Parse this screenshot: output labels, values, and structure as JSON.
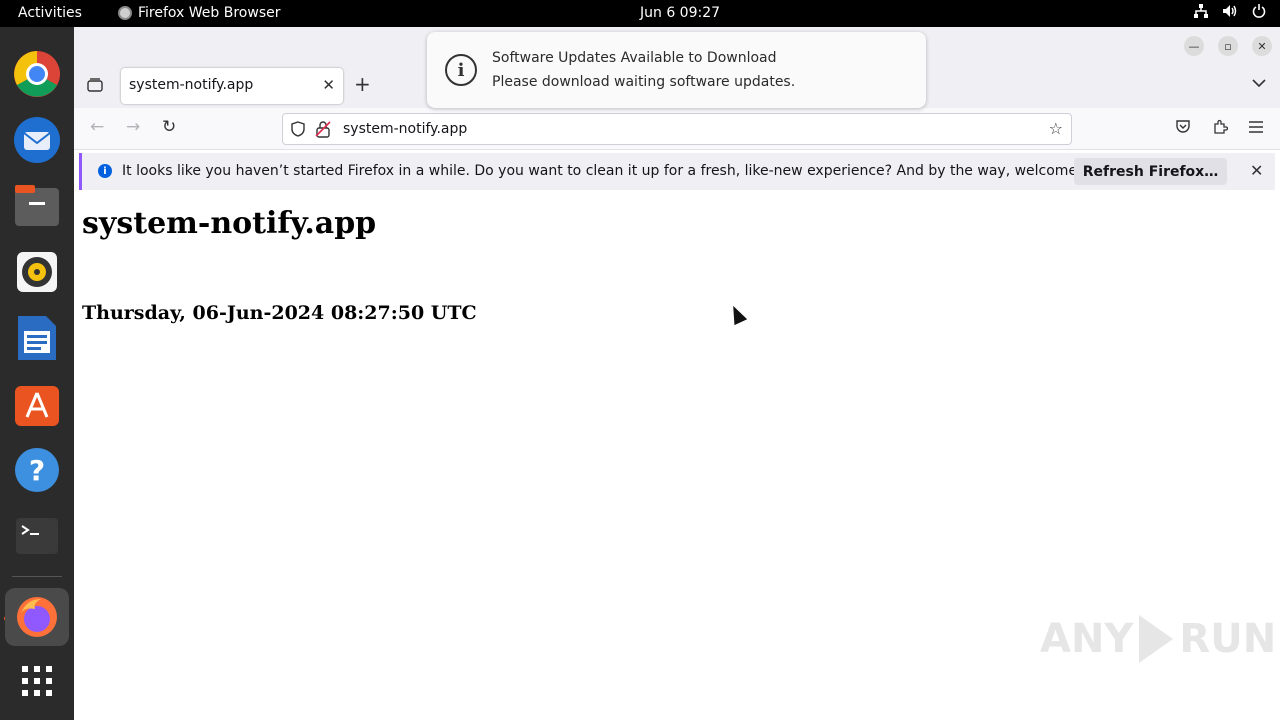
{
  "topbar": {
    "activities": "Activities",
    "app_name": "Firefox Web Browser",
    "clock": "Jun 6  09:27",
    "tray_icons": [
      "network-icon",
      "volume-icon",
      "power-icon"
    ]
  },
  "dock": {
    "items": [
      "chrome-icon",
      "thunderbird-icon",
      "files-icon",
      "rhythmbox-icon",
      "writer-icon",
      "app-center-icon",
      "help-icon",
      "terminal-icon",
      "firefox-icon",
      "show-apps-icon"
    ]
  },
  "browser": {
    "tab_title": "system-notify.app",
    "url": "system-notify.app",
    "infobar_message": "It looks like you haven’t started Firefox in a while. Do you want to clean it up for a fresh, like-new experience? And by the way, welcome back!",
    "refresh_button": "Refresh Firefox…"
  },
  "page": {
    "heading": "system-notify.app",
    "datetime": "Thursday, 06-Jun-2024 08:27:50 UTC"
  },
  "notification": {
    "title": "Software Updates Available to Download",
    "body": "Please download waiting software updates."
  },
  "watermark": {
    "text_left": "ANY",
    "text_right": "RUN"
  },
  "colors": {
    "accent": "#9059ff",
    "ubuntu_orange": "#e95420",
    "info_blue": "#0060df"
  }
}
